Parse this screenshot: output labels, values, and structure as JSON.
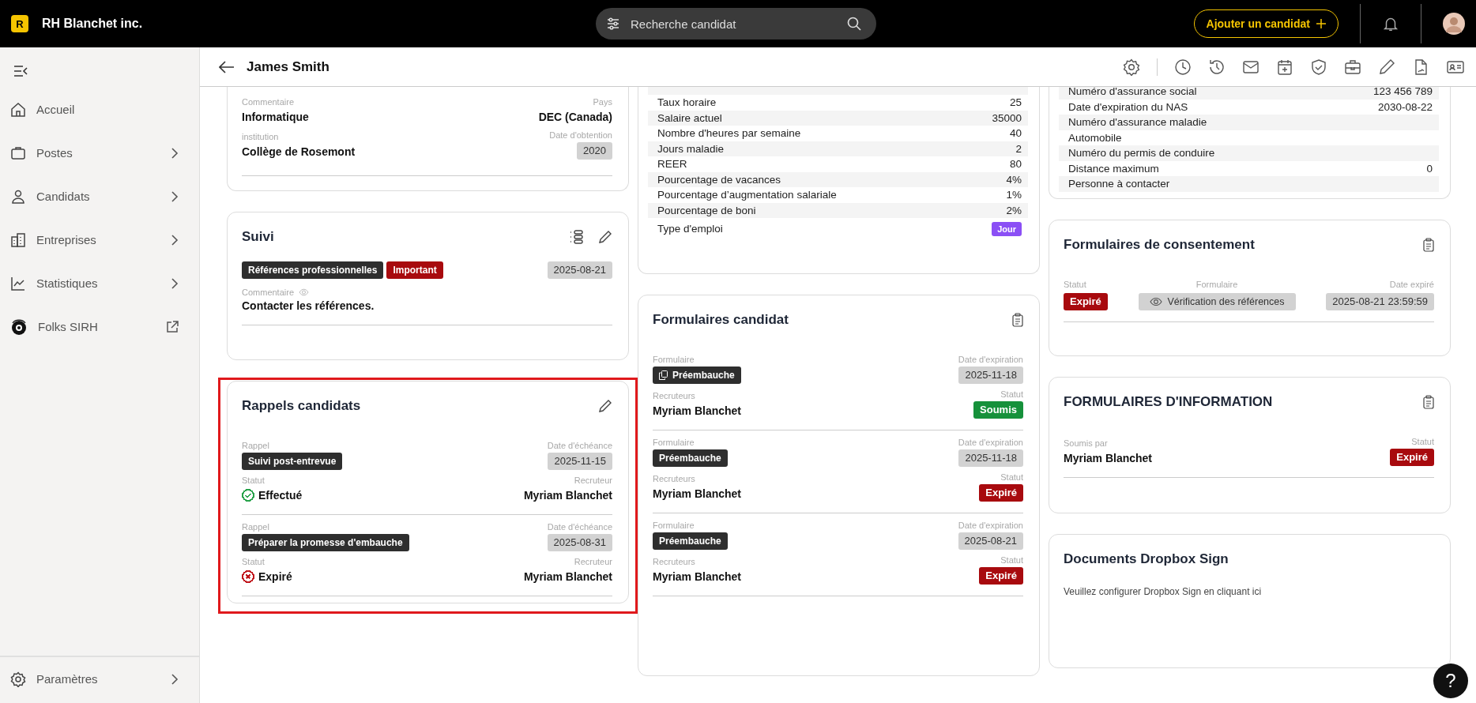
{
  "topbar": {
    "logo_letter": "R",
    "brand": "RH Blanchet inc.",
    "search": {
      "placeholder": "Recherche candidat"
    },
    "add_button": "Ajouter un candidat"
  },
  "header": {
    "title": "James Smith"
  },
  "sidebar": {
    "items": [
      {
        "label": "Accueil",
        "kind": "home",
        "submenu": false
      },
      {
        "label": "Postes",
        "kind": "jobs",
        "submenu": true
      },
      {
        "label": "Candidats",
        "kind": "candidates",
        "submenu": true
      },
      {
        "label": "Entreprises",
        "kind": "companies",
        "submenu": true
      },
      {
        "label": "Statistiques",
        "kind": "stats",
        "submenu": true
      },
      {
        "label": "Folks SIRH",
        "kind": "external",
        "submenu": false
      }
    ],
    "footer": {
      "label": "Paramètres"
    }
  },
  "education_card": {
    "rows": [
      {
        "left": {
          "label": "Commentaire",
          "value": "Informatique"
        },
        "right": {
          "label": "Pays",
          "value": "DEC (Canada)",
          "kind": "text"
        }
      },
      {
        "left": {
          "label": "institution",
          "value": "Collège de Rosemont"
        },
        "right": {
          "label": "Date d'obtention",
          "value": "2020",
          "kind": "badge"
        }
      }
    ]
  },
  "suivi": {
    "title": "Suivi",
    "tags": [
      {
        "text": "Références professionnelles",
        "kind": "dark"
      },
      {
        "text": "Important",
        "kind": "danger"
      }
    ],
    "date": "2025-08-21",
    "comment_label": "Commentaire",
    "comment": "Contacter les références."
  },
  "rappels": {
    "title": "Rappels candidats",
    "highlighted": true,
    "items": [
      {
        "rappel_label": "Rappel",
        "rappel": "Suivi post-entrevue",
        "date_label": "Date d'échéance",
        "date": "2025-11-15",
        "status_label": "Statut",
        "status": "Effectué",
        "kind": "done",
        "color": "#27a24a",
        "recruiter_label": "Recruteur",
        "recruiter": "Myriam Blanchet"
      },
      {
        "rappel_label": "Rappel",
        "rappel": "Préparer la promesse d'embauche",
        "date_label": "Date d'échéance",
        "date": "2025-08-31",
        "status_label": "Statut",
        "status": "Expiré",
        "kind": "expired",
        "color": "#c0161c",
        "recruiter_label": "Recruteur",
        "recruiter": "Myriam Blanchet"
      }
    ]
  },
  "job_profile": {
    "rows": [
      {
        "label": "Taux horaire",
        "value": "25",
        "kind": "text"
      },
      {
        "label": "Salaire actuel",
        "value": "35000",
        "kind": "text"
      },
      {
        "label": "Nombre d'heures par semaine",
        "value": "40",
        "kind": "text"
      },
      {
        "label": "Jours maladie",
        "value": "2",
        "kind": "text"
      },
      {
        "label": "REER",
        "value": "80",
        "kind": "text"
      },
      {
        "label": "Pourcentage de vacances",
        "value": "4%",
        "kind": "text"
      },
      {
        "label": "Pourcentage d’augmentation salariale",
        "value": "1%",
        "kind": "text"
      },
      {
        "label": "Pourcentage de boni",
        "value": "2%",
        "kind": "text"
      },
      {
        "label": "Type d'emploi",
        "value": "Jour",
        "kind": "badge"
      }
    ]
  },
  "candidate_forms": {
    "title": "Formulaires candidat",
    "items": [
      {
        "form_label": "Formulaire",
        "form": "Préembauche",
        "copy_icon": true,
        "date_label": "Date d'expiration",
        "date": "2025-11-18",
        "recruiters_label": "Recruteurs",
        "recruiter": "Myriam Blanchet",
        "status_label": "Statut",
        "status": "Soumis",
        "color": "#16913b"
      },
      {
        "form_label": "Formulaire",
        "form": "Préembauche",
        "copy_icon": false,
        "date_label": "Date d'expiration",
        "date": "2025-11-18",
        "recruiters_label": "Recruteurs",
        "recruiter": "Myriam Blanchet",
        "status_label": "Statut",
        "status": "Expiré",
        "color": "#a80a0e"
      },
      {
        "form_label": "Formulaire",
        "form": "Préembauche",
        "copy_icon": false,
        "date_label": "Date d'expiration",
        "date": "2025-08-21",
        "recruiters_label": "Recruteurs",
        "recruiter": "Myriam Blanchet",
        "status_label": "Statut",
        "status": "Expiré",
        "color": "#a80a0e"
      }
    ]
  },
  "extra_info": {
    "rows": [
      {
        "label": "Numéro d'assurance social",
        "value": "123 456 789"
      },
      {
        "label": "Date d'expiration du NAS",
        "value": "2030-08-22"
      },
      {
        "label": "Numéro d'assurance maladie"
      },
      {
        "label": "Automobile"
      },
      {
        "label": "Numéro du permis de conduire"
      },
      {
        "label": "Distance maximum",
        "value": "0"
      },
      {
        "label": "Personne à contacter"
      }
    ]
  },
  "consent_forms": {
    "title": "Formulaires de consentement",
    "columns": [
      "Statut",
      "Formulaire",
      "Date expiré"
    ],
    "items": [
      {
        "status": "Expiré",
        "color": "#a80a0e",
        "form": "Vérification des références",
        "date": "2025-08-21 23:59:59"
      }
    ]
  },
  "info_forms": {
    "title": "FORMULAIRES D'INFORMATION",
    "items": [
      {
        "submitted_label": "Soumis par",
        "submitted_by": "Myriam Blanchet",
        "status_label": "Statut",
        "status": "Expiré",
        "color": "#a80a0e"
      }
    ]
  },
  "dropbox": {
    "title": "Documents Dropbox Sign",
    "message": "Veuillez configurer Dropbox Sign en cliquant ici"
  },
  "help_button": {
    "label": "?"
  }
}
